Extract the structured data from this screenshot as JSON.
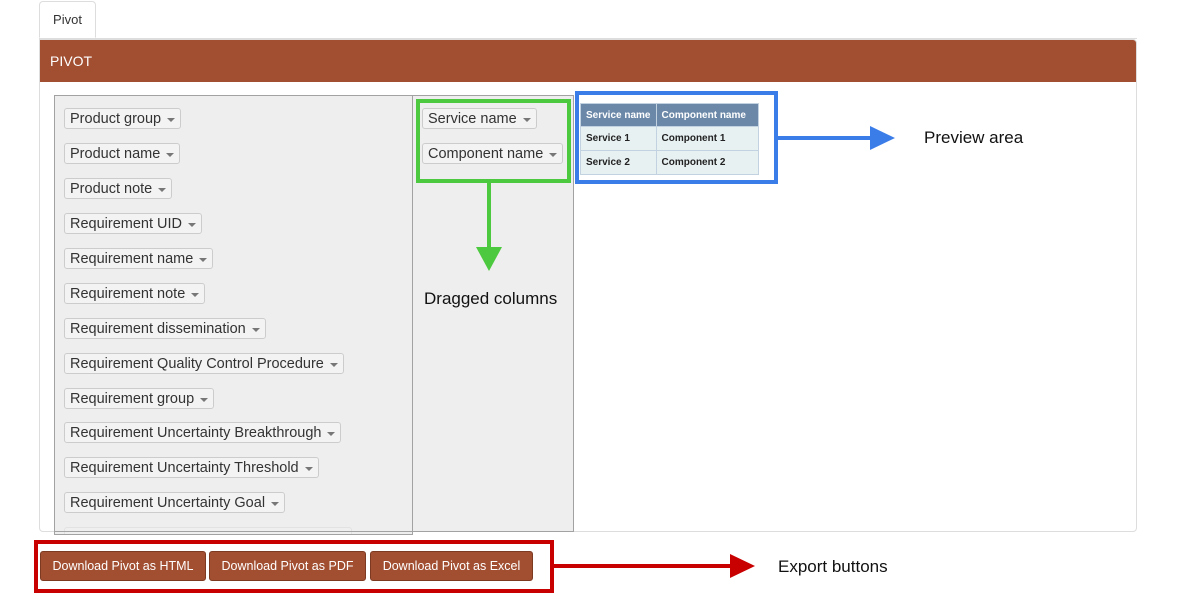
{
  "tab": {
    "label": "Pivot"
  },
  "panel": {
    "title": "PIVOT"
  },
  "attributes": [
    "Product group",
    "Product name",
    "Product note",
    "Requirement UID",
    "Requirement name",
    "Requirement note",
    "Requirement dissemination",
    "Requirement Quality Control Procedure",
    "Requirement group",
    "Requirement Uncertainty Breakthrough",
    "Requirement Uncertainty Threshold",
    "Requirement Uncertainty Goal"
  ],
  "row_fields": [
    "Service name",
    "Component name"
  ],
  "preview_table": {
    "headers": [
      "Service name",
      "Component name"
    ],
    "rows": [
      [
        "Service 1",
        "Component 1"
      ],
      [
        "Service 2",
        "Component 2"
      ]
    ]
  },
  "buttons": {
    "html": "Download Pivot as HTML",
    "pdf": "Download Pivot as PDF",
    "excel": "Download Pivot as Excel"
  },
  "annotations": {
    "preview": "Preview area",
    "dragged": "Dragged columns",
    "export": "Export buttons"
  },
  "colors": {
    "brand": "#a14e31",
    "table_header": "#6b88a8",
    "table_cell": "#e8f1f2",
    "annotation_green": "#4dc93f",
    "annotation_blue": "#3b7de8",
    "annotation_red": "#c80000"
  }
}
